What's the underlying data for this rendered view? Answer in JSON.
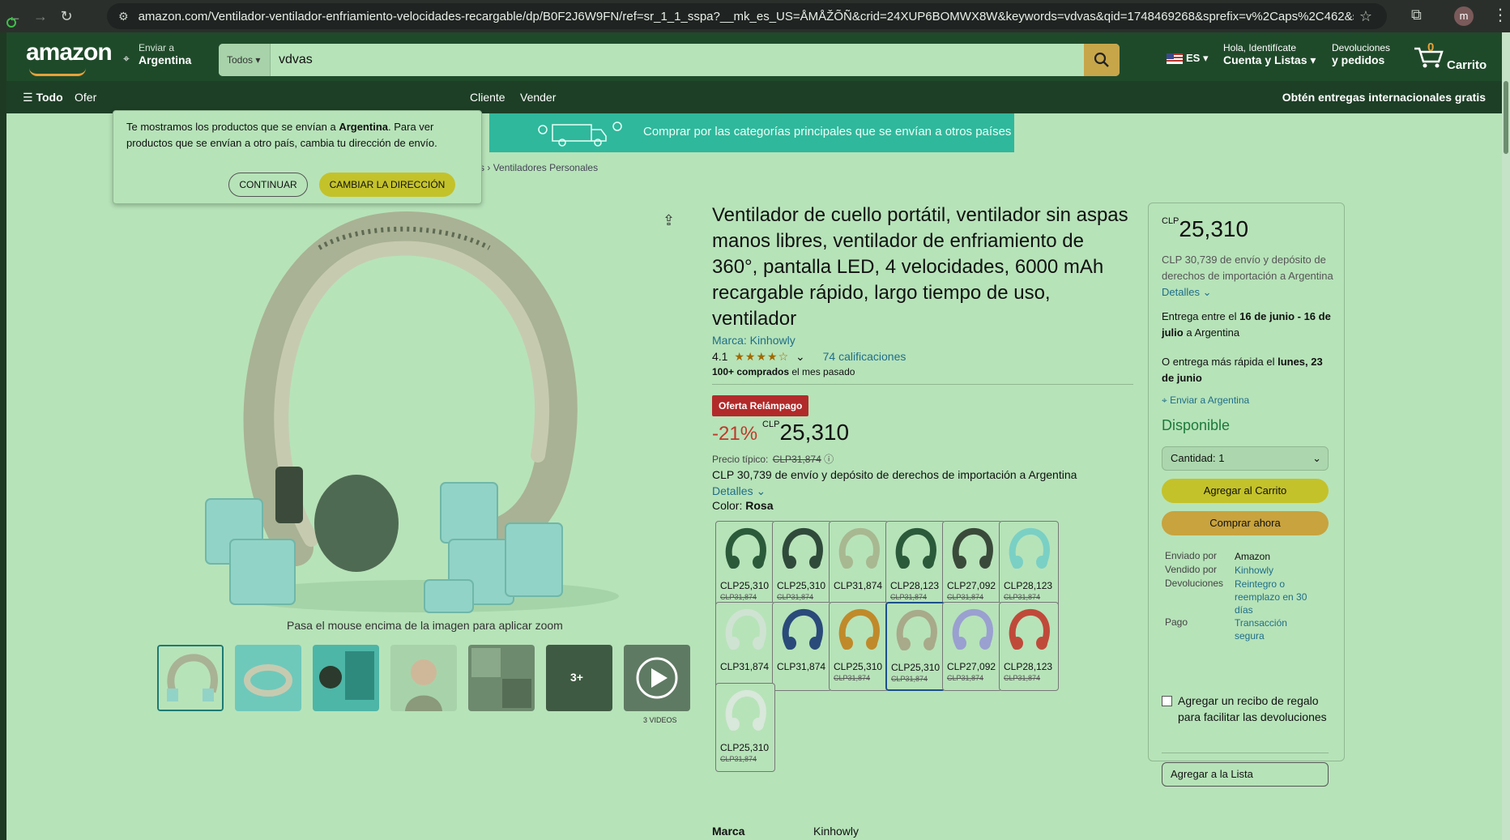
{
  "browser": {
    "url": "amazon.com/Ventilador-ventilador-enfriamiento-velocidades-recargable/dp/B0F2J6W9FN/ref=sr_1_1_sspa?__mk_es_US=ÅMÅŽÕÑ&crid=24XUP6BOMWX8W&keywords=vdvas&qid=1748469268&sprefix=v%2Caps%2C462&sr=8-1-spons&sp_c...",
    "profile_initial": "m"
  },
  "header": {
    "logo": "amazon",
    "deliver_to_label": "Enviar a",
    "deliver_to_value": "Argentina",
    "search_category": "Todos",
    "search_value": "vdvas",
    "language": "ES",
    "account_l1": "Hola, Identifícate",
    "account_l2": "Cuenta y Listas",
    "returns_l1": "Devoluciones",
    "returns_l2": "y pedidos",
    "cart_count": "0",
    "cart_label": "Carrito"
  },
  "subnav": {
    "all": "Todo",
    "items": [
      "Ofer",
      "Cliente",
      "Vender"
    ],
    "promo": "Obtén entregas internacionales gratis"
  },
  "popup": {
    "text_pre": "Te mostramos los productos que se envían a ",
    "text_bold": "Argentina",
    "text_post": ". Para ver productos que se envían a otro país, cambia tu dirección de envío.",
    "continue_label": "CONTINUAR",
    "change_label": "CAMBIAR LA DIRECCIÓN"
  },
  "banner": {
    "text": "Comprar por las categorías principales que se envían a otros países"
  },
  "breadcrumb": {
    "partial": "s",
    "sep": "›",
    "current": "Ventiladores Personales"
  },
  "gallery": {
    "zoom_hint": "Pasa el mouse encima de la imagen para aplicar zoom",
    "more_count": "3+",
    "videos_label": "3 VIDEOS"
  },
  "product": {
    "title": "Ventilador de cuello portátil, ventilador sin aspas manos libres, ventilador de enfriamiento de 360°, pantalla LED, 4 velocidades, 6000 mAh recargable rápido, largo tiempo de uso, ventilador",
    "brand": "Marca: Kinhowly",
    "rating_value": "4.1",
    "rating_stars": 4.1,
    "stars_glyphs": "★★★★☆",
    "rating_count": "74 calificaciones",
    "bought_bold": "100+ comprados",
    "bought_rest": " el mes pasado",
    "deal_badge": "Oferta Relámpago",
    "discount": "-21%",
    "currency": "CLP",
    "price": "25,310",
    "typical_label": "Precio típico:",
    "typical_price": "CLP31,874",
    "shipping_text": "CLP 30,739 de envío y depósito de derechos de importación a Argentina",
    "details_link": "Detalles",
    "color_label": "Color:",
    "color_value": "Rosa",
    "swatches": [
      {
        "price": "CLP25,310",
        "old": "CLP31,874",
        "color": "#2a5a3a"
      },
      {
        "price": "CLP25,310",
        "old": "CLP31,874",
        "color": "#2f4a3a"
      },
      {
        "price": "CLP31,874",
        "old": "",
        "color": "#a8b890"
      },
      {
        "price": "CLP28,123",
        "old": "CLP31,874",
        "color": "#2a5a3a"
      },
      {
        "price": "CLP27,092",
        "old": "CLP31,874",
        "color": "#3a4a3a"
      },
      {
        "price": "CLP28,123",
        "old": "CLP31,874",
        "color": "#7ad0c4"
      },
      {
        "price": "CLP31,874",
        "old": "",
        "color": "#cfe3d2"
      },
      {
        "price": "CLP31,874",
        "old": "",
        "color": "#2a4a7a"
      },
      {
        "price": "CLP25,310",
        "old": "CLP31,874",
        "color": "#c08a2a"
      },
      {
        "price": "CLP25,310",
        "old": "CLP31,874",
        "color": "#a8aa8a"
      },
      {
        "price": "CLP27,092",
        "old": "CLP31,874",
        "color": "#9aa0d0"
      },
      {
        "price": "CLP28,123",
        "old": "CLP31,874",
        "color": "#c04a3a"
      },
      {
        "price": "CLP25,310",
        "old": "CLP31,874",
        "color": "#d8e8da"
      }
    ],
    "selected_swatch": 9,
    "spec_label": "Marca",
    "spec_value": "Kinhowly"
  },
  "buybox": {
    "currency": "CLP",
    "price": "25,310",
    "shipping_text": "CLP 30,739 de envío y depósito de derechos de importación a Argentina ",
    "details_link": "Detalles",
    "delivery_pre": "Entrega entre el ",
    "delivery_d1": "16 de junio - 16 de julio",
    "delivery_post": " a Argentina",
    "fast_pre": "O entrega más rápida el ",
    "fast_date": "lunes, 23 de junio",
    "ship_to": "Enviar a Argentina",
    "availability": "Disponible",
    "quantity": "Cantidad: 1",
    "add_to_cart": "Agregar al Carrito",
    "buy_now": "Comprar ahora",
    "shipped_by_label": "Enviado por",
    "shipped_by": "Amazon",
    "sold_by_label": "Vendido por",
    "sold_by": "Kinhowly",
    "returns_label": "Devoluciones",
    "returns": "Reintegro o reemplazo en 30 días",
    "payment_label": "Pago",
    "payment": "Transacción segura",
    "gift": "Agregar un recibo de regalo para facilitar las devoluciones",
    "add_to_list": "Agregar a la Lista"
  }
}
